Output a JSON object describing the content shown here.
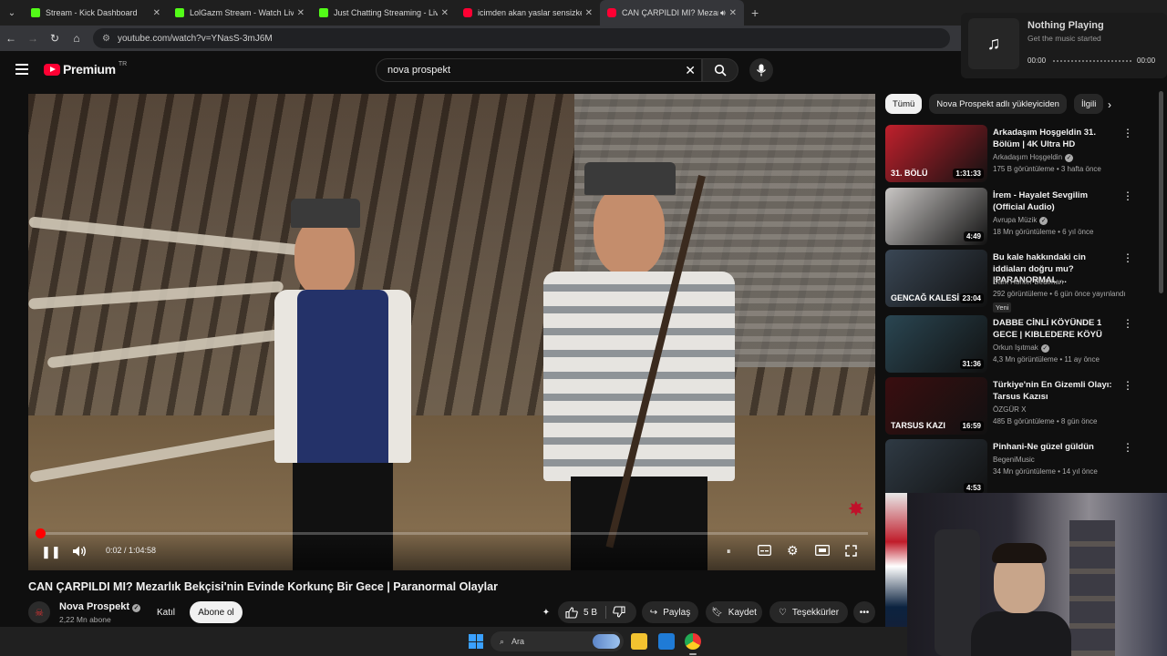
{
  "browser": {
    "tabs": [
      {
        "title": "Stream - Kick Dashboard",
        "icon": "kick-icon",
        "active": false
      },
      {
        "title": "LolGazm Stream - Watch Live o",
        "icon": "kick-icon",
        "active": false
      },
      {
        "title": "Just Chatting Streaming - Live S",
        "icon": "kick-icon",
        "active": false
      },
      {
        "title": "icimden akan yaslar sensizken y",
        "icon": "youtube-icon",
        "active": false
      },
      {
        "title": "CAN ÇARPILDI MI? Mezarlı",
        "icon": "youtube-icon",
        "active": true
      }
    ],
    "url": "youtube.com/watch?v=YNasS-3mJ6M"
  },
  "youtube": {
    "logo_text": "Premium",
    "logo_region": "TR",
    "search_query": "nova prospekt"
  },
  "player": {
    "time_current": "0:02",
    "time_total": "1:04:58",
    "time_display": "0:02 / 1:04:58",
    "progress_fraction": 0.0005,
    "accent": "#ff0000"
  },
  "video": {
    "title": "CAN ÇARPILDI MI? Mezarlık Bekçisi'nin Evinde Korkunç Bir Gece | Paranormal Olaylar",
    "channel": "Nova Prospekt",
    "subscribers": "2,22 Mn abone",
    "join_label": "Katıl",
    "subscribe_label": "Abone ol",
    "likes": "5 B",
    "share_label": "Paylaş",
    "save_label": "Kaydet",
    "thanks_label": "Teşekkürler"
  },
  "sidebar": {
    "chips": [
      "Tümü",
      "Nova Prospekt adlı yükleyiciden",
      "İlgili"
    ],
    "recommendations": [
      {
        "title": "Arkadaşım Hoşgeldin 31. Bölüm | 4K Ultra HD",
        "channel": "Arkadaşım Hoşgeldin",
        "verified": true,
        "meta": "175 B görüntüleme • 3 hafta önce",
        "duration": "1:31:33",
        "thumb_color": "#c0202c",
        "thumb_text": "31. BÖLÜ"
      },
      {
        "title": "İrem - Hayalet Sevgilim (Official Audio)",
        "channel": "Avrupa Müzik",
        "verified": true,
        "meta": "18 Mn görüntüleme • 6 yıl önce",
        "duration": "4:49",
        "thumb_color": "#c9c6c4",
        "thumb_text": ""
      },
      {
        "title": "Bu kale hakkındaki cin iddiaları doğru mu? |PARANORMAL ...",
        "channel": "Dark Hunter Bedirhan",
        "verified": false,
        "meta": "292 görüntüleme • 6 gün önce yayınlandı",
        "duration": "23:04",
        "thumb_color": "#3a4755",
        "thumb_text": "GENCAĞ KALESİ",
        "badge": "Yeni"
      },
      {
        "title": "DABBE CİNLİ KÖYÜNDE 1 GECE | KIBLEDERE KÖYÜ",
        "channel": "Orkun Işıtmak",
        "verified": true,
        "meta": "4,3 Mn görüntüleme • 11 ay önce",
        "duration": "31:36",
        "thumb_color": "#2a4652",
        "thumb_text": ""
      },
      {
        "title": "Türkiye'nin En Gizemli Olayı: Tarsus Kazısı",
        "channel": "ÖZGÜR X",
        "verified": false,
        "meta": "485 B görüntüleme • 8 gün önce",
        "duration": "16:59",
        "thumb_color": "#3a0e10",
        "thumb_text": "TARSUS KAZI"
      },
      {
        "title": "Pinhani-Ne güzel güldün",
        "channel": "BegeniMusic",
        "verified": false,
        "meta": "34 Mn görüntüleme • 14 yıl önce",
        "duration": "4:53",
        "thumb_color": "#2f3a44",
        "thumb_text": ""
      }
    ]
  },
  "music_widget": {
    "title": "Nothing Playing",
    "subtitle": "Get the music started",
    "time_start": "00:00",
    "time_end": "00:00"
  },
  "taskbar": {
    "search_placeholder": "Ara"
  }
}
